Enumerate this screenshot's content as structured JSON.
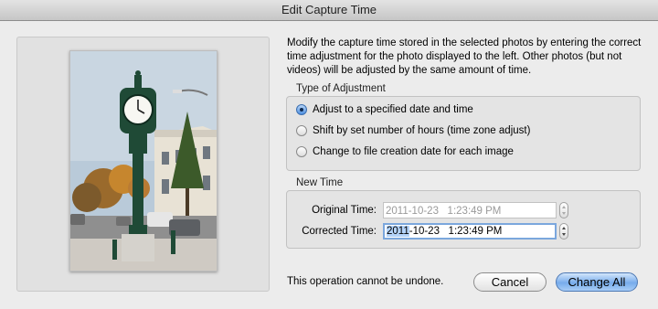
{
  "window": {
    "title": "Edit Capture Time"
  },
  "description": "Modify the capture time stored in the selected photos by entering the correct time adjustment for the photo displayed to the left. Other photos (but not videos) will be adjusted by the same amount of time.",
  "adjustment": {
    "label": "Type of Adjustment",
    "options": [
      {
        "label": "Adjust to a specified date and time",
        "selected": true
      },
      {
        "label": "Shift by set number of hours (time zone adjust)",
        "selected": false
      },
      {
        "label": "Change to file creation date for each image",
        "selected": false
      }
    ]
  },
  "new_time": {
    "label": "New Time",
    "original_label": "Original Time:",
    "original_value": "2011-10-23   1:23:49 PM",
    "corrected_label": "Corrected Time:",
    "corrected_selected": "2011",
    "corrected_rest": "-10-23   1:23:49 PM"
  },
  "footer": {
    "note": "This operation cannot be undone.",
    "cancel_label": "Cancel",
    "change_all_label": "Change All"
  },
  "colors": {
    "accent": "#4d8fe0",
    "selection": "#b3d3f9",
    "primary_button": "#77acec"
  }
}
